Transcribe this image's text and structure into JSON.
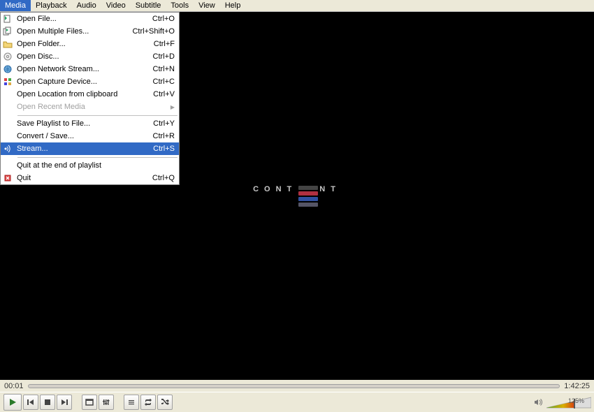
{
  "menubar": {
    "items": [
      "Media",
      "Playback",
      "Audio",
      "Video",
      "Subtitle",
      "Tools",
      "View",
      "Help"
    ],
    "active_index": 0
  },
  "media_menu": {
    "open_file": "Open File...",
    "open_file_sc": "Ctrl+O",
    "open_multi": "Open Multiple Files...",
    "open_multi_sc": "Ctrl+Shift+O",
    "open_folder": "Open Folder...",
    "open_folder_sc": "Ctrl+F",
    "open_disc": "Open Disc...",
    "open_disc_sc": "Ctrl+D",
    "open_net": "Open Network Stream...",
    "open_net_sc": "Ctrl+N",
    "open_capture": "Open Capture Device...",
    "open_capture_sc": "Ctrl+C",
    "open_clip": "Open Location from clipboard",
    "open_clip_sc": "Ctrl+V",
    "open_recent": "Open Recent Media",
    "save_playlist": "Save Playlist to File...",
    "save_playlist_sc": "Ctrl+Y",
    "convert": "Convert / Save...",
    "convert_sc": "Ctrl+R",
    "stream": "Stream...",
    "stream_sc": "Ctrl+S",
    "quit_end": "Quit at the end of playlist",
    "quit": "Quit",
    "quit_sc": "Ctrl+Q"
  },
  "logo_text_left": "CONT",
  "logo_text_right": "NT",
  "time_elapsed": "00:01",
  "time_total": "1:42:25",
  "volume_pct": "125%"
}
